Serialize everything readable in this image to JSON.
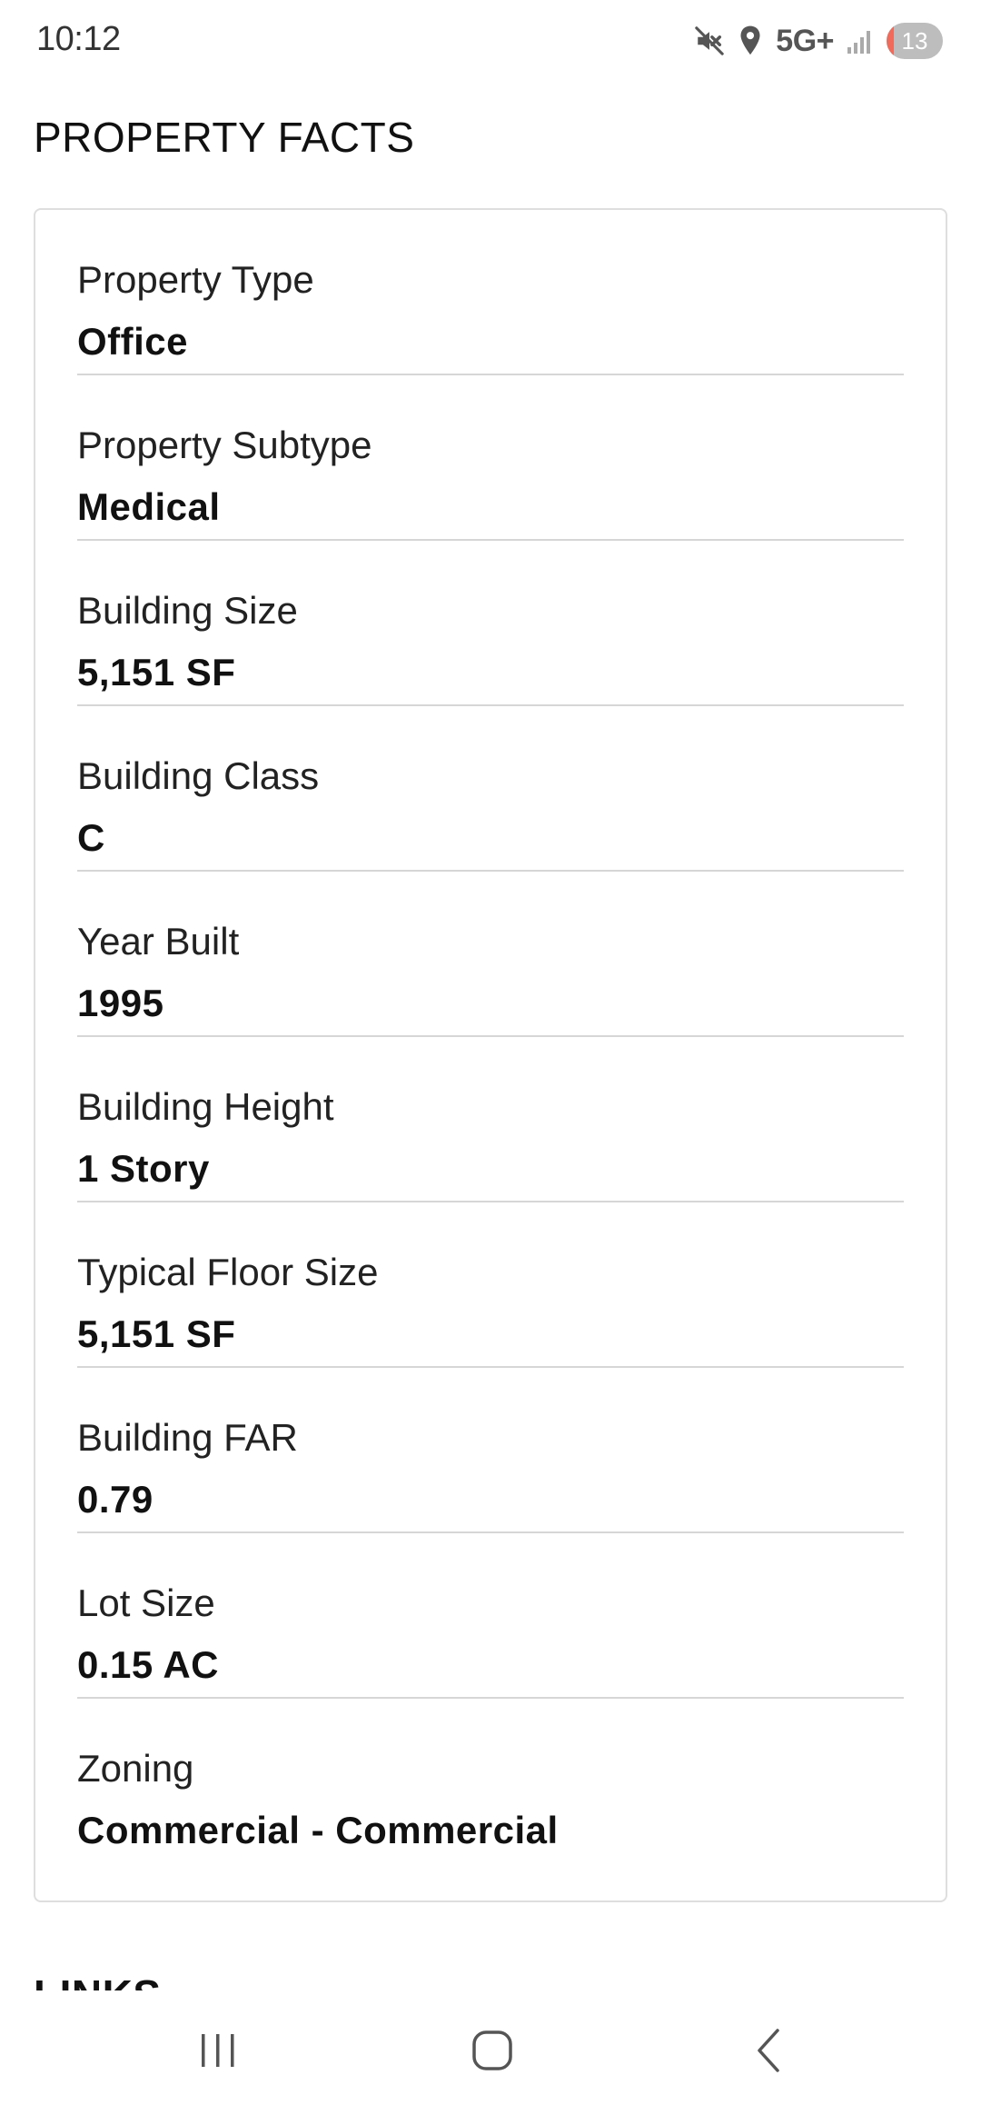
{
  "status_bar": {
    "time": "10:12",
    "network": "5G+",
    "battery_level": "13",
    "icons": [
      "mute-icon",
      "location-icon",
      "signal-icon",
      "battery-icon"
    ]
  },
  "page": {
    "title": "PROPERTY FACTS",
    "next_section_title": "LINKS"
  },
  "facts": [
    {
      "label": "Property Type",
      "value": "Office"
    },
    {
      "label": "Property Subtype",
      "value": "Medical"
    },
    {
      "label": "Building Size",
      "value": "5,151 SF"
    },
    {
      "label": "Building Class",
      "value": "C"
    },
    {
      "label": "Year Built",
      "value": "1995"
    },
    {
      "label": "Building Height",
      "value": "1 Story"
    },
    {
      "label": "Typical Floor Size",
      "value": "5,151 SF"
    },
    {
      "label": "Building FAR",
      "value": "0.79"
    },
    {
      "label": "Lot Size",
      "value": "0.15 AC"
    },
    {
      "label": "Zoning",
      "value": "Commercial - Commercial"
    }
  ],
  "nav_bar": {
    "buttons": [
      "recents-icon",
      "home-icon",
      "back-icon"
    ]
  },
  "colors": {
    "battery_low": "#f06b5b",
    "divider": "#d6d6d6",
    "card_border": "#dedede"
  }
}
